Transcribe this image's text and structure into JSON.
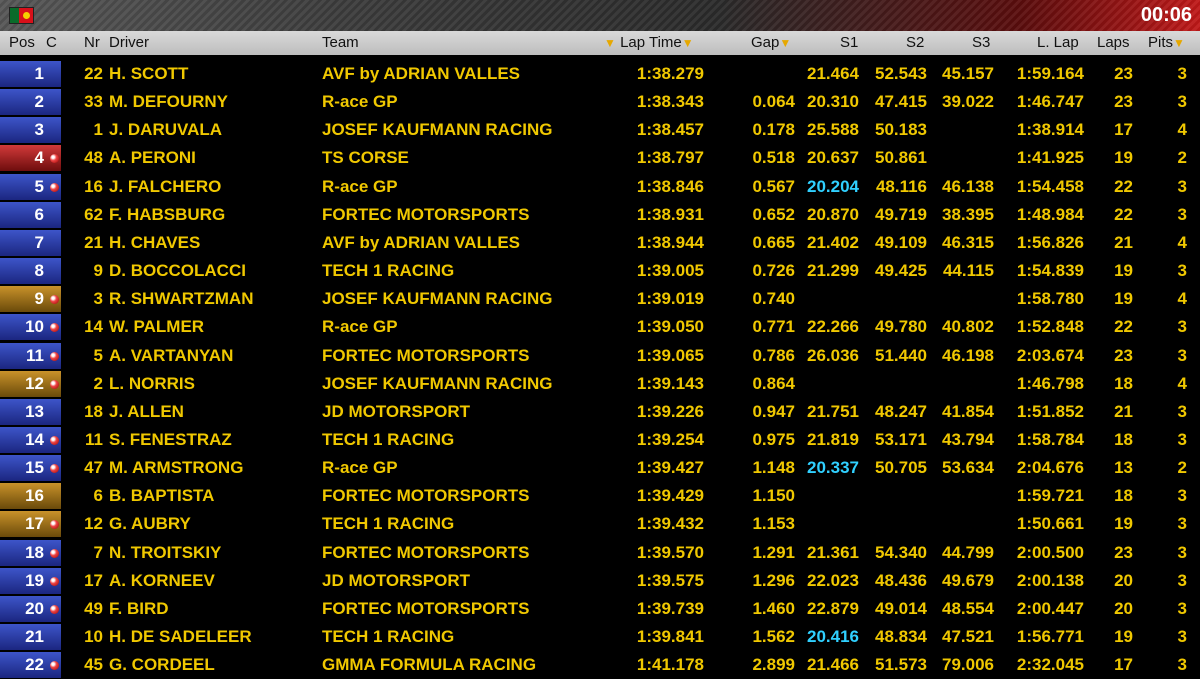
{
  "topbar": {
    "clock": "00:06",
    "flag_icon": "portugal-flag-icon"
  },
  "header": {
    "pos": "Pos",
    "c": "C",
    "nr": "Nr",
    "driver": "Driver",
    "team": "Team",
    "lap_time": "Lap Time",
    "gap": "Gap",
    "s1": "S1",
    "s2": "S2",
    "s3": "S3",
    "last_lap": "L. Lap",
    "laps": "Laps",
    "pits": "Pits"
  },
  "colors": {
    "blue": "#2a3aa8",
    "red": "#b02020",
    "orange": "#a87418",
    "text": "#f0c800",
    "best_sector": "#30d0ff"
  },
  "rows": [
    {
      "pos": "1",
      "status": "blue",
      "dot": false,
      "nr": "22",
      "driver": "H. SCOTT",
      "team": "AVF by ADRIAN VALLES",
      "lap": "1:38.279",
      "gap": "",
      "s1": "21.464",
      "s2": "52.543",
      "s3": "45.157",
      "llap": "1:59.164",
      "laps": "23",
      "pits": "3",
      "s1_best": false
    },
    {
      "pos": "2",
      "status": "blue",
      "dot": false,
      "nr": "33",
      "driver": "M. DEFOURNY",
      "team": "R-ace GP",
      "lap": "1:38.343",
      "gap": "0.064",
      "s1": "20.310",
      "s2": "47.415",
      "s3": "39.022",
      "llap": "1:46.747",
      "laps": "23",
      "pits": "3",
      "s1_best": false
    },
    {
      "pos": "3",
      "status": "blue",
      "dot": false,
      "nr": "1",
      "driver": "J. DARUVALA",
      "team": "JOSEF KAUFMANN RACING",
      "lap": "1:38.457",
      "gap": "0.178",
      "s1": "25.588",
      "s2": "50.183",
      "s3": "",
      "llap": "1:38.914",
      "laps": "17",
      "pits": "4",
      "s1_best": false
    },
    {
      "pos": "4",
      "status": "red",
      "dot": true,
      "nr": "48",
      "driver": "A. PERONI",
      "team": "TS CORSE",
      "lap": "1:38.797",
      "gap": "0.518",
      "s1": "20.637",
      "s2": "50.861",
      "s3": "",
      "llap": "1:41.925",
      "laps": "19",
      "pits": "2",
      "s1_best": false
    },
    {
      "pos": "5",
      "status": "blue",
      "dot": true,
      "nr": "16",
      "driver": "J. FALCHERO",
      "team": "R-ace GP",
      "lap": "1:38.846",
      "gap": "0.567",
      "s1": "20.204",
      "s2": "48.116",
      "s3": "46.138",
      "llap": "1:54.458",
      "laps": "22",
      "pits": "3",
      "s1_best": true
    },
    {
      "pos": "6",
      "status": "blue",
      "dot": false,
      "nr": "62",
      "driver": "F. HABSBURG",
      "team": "FORTEC MOTORSPORTS",
      "lap": "1:38.931",
      "gap": "0.652",
      "s1": "20.870",
      "s2": "49.719",
      "s3": "38.395",
      "llap": "1:48.984",
      "laps": "22",
      "pits": "3",
      "s1_best": false
    },
    {
      "pos": "7",
      "status": "blue",
      "dot": false,
      "nr": "21",
      "driver": "H. CHAVES",
      "team": "AVF by ADRIAN VALLES",
      "lap": "1:38.944",
      "gap": "0.665",
      "s1": "21.402",
      "s2": "49.109",
      "s3": "46.315",
      "llap": "1:56.826",
      "laps": "21",
      "pits": "4",
      "s1_best": false
    },
    {
      "pos": "8",
      "status": "blue",
      "dot": false,
      "nr": "9",
      "driver": "D. BOCCOLACCI",
      "team": "TECH 1 RACING",
      "lap": "1:39.005",
      "gap": "0.726",
      "s1": "21.299",
      "s2": "49.425",
      "s3": "44.115",
      "llap": "1:54.839",
      "laps": "19",
      "pits": "3",
      "s1_best": false
    },
    {
      "pos": "9",
      "status": "orange",
      "dot": true,
      "nr": "3",
      "driver": "R. SHWARTZMAN",
      "team": "JOSEF KAUFMANN RACING",
      "lap": "1:39.019",
      "gap": "0.740",
      "s1": "",
      "s2": "",
      "s3": "",
      "llap": "1:58.780",
      "laps": "19",
      "pits": "4",
      "s1_best": false
    },
    {
      "pos": "10",
      "status": "blue",
      "dot": true,
      "nr": "14",
      "driver": "W. PALMER",
      "team": "R-ace GP",
      "lap": "1:39.050",
      "gap": "0.771",
      "s1": "22.266",
      "s2": "49.780",
      "s3": "40.802",
      "llap": "1:52.848",
      "laps": "22",
      "pits": "3",
      "s1_best": false
    },
    {
      "pos": "11",
      "status": "blue",
      "dot": true,
      "nr": "5",
      "driver": "A. VARTANYAN",
      "team": "FORTEC MOTORSPORTS",
      "lap": "1:39.065",
      "gap": "0.786",
      "s1": "26.036",
      "s2": "51.440",
      "s3": "46.198",
      "llap": "2:03.674",
      "laps": "23",
      "pits": "3",
      "s1_best": false
    },
    {
      "pos": "12",
      "status": "orange",
      "dot": true,
      "nr": "2",
      "driver": "L. NORRIS",
      "team": "JOSEF KAUFMANN RACING",
      "lap": "1:39.143",
      "gap": "0.864",
      "s1": "",
      "s2": "",
      "s3": "",
      "llap": "1:46.798",
      "laps": "18",
      "pits": "4",
      "s1_best": false
    },
    {
      "pos": "13",
      "status": "blue",
      "dot": false,
      "nr": "18",
      "driver": "J. ALLEN",
      "team": "JD MOTORSPORT",
      "lap": "1:39.226",
      "gap": "0.947",
      "s1": "21.751",
      "s2": "48.247",
      "s3": "41.854",
      "llap": "1:51.852",
      "laps": "21",
      "pits": "3",
      "s1_best": false
    },
    {
      "pos": "14",
      "status": "blue",
      "dot": true,
      "nr": "11",
      "driver": "S. FENESTRAZ",
      "team": "TECH 1 RACING",
      "lap": "1:39.254",
      "gap": "0.975",
      "s1": "21.819",
      "s2": "53.171",
      "s3": "43.794",
      "llap": "1:58.784",
      "laps": "18",
      "pits": "3",
      "s1_best": false
    },
    {
      "pos": "15",
      "status": "blue",
      "dot": true,
      "nr": "47",
      "driver": "M. ARMSTRONG",
      "team": "R-ace GP",
      "lap": "1:39.427",
      "gap": "1.148",
      "s1": "20.337",
      "s2": "50.705",
      "s3": "53.634",
      "llap": "2:04.676",
      "laps": "13",
      "pits": "2",
      "s1_best": true
    },
    {
      "pos": "16",
      "status": "orange",
      "dot": false,
      "nr": "6",
      "driver": "B. BAPTISTA",
      "team": "FORTEC MOTORSPORTS",
      "lap": "1:39.429",
      "gap": "1.150",
      "s1": "",
      "s2": "",
      "s3": "",
      "llap": "1:59.721",
      "laps": "18",
      "pits": "3",
      "s1_best": false
    },
    {
      "pos": "17",
      "status": "orange",
      "dot": true,
      "nr": "12",
      "driver": "G. AUBRY",
      "team": "TECH 1 RACING",
      "lap": "1:39.432",
      "gap": "1.153",
      "s1": "",
      "s2": "",
      "s3": "",
      "llap": "1:50.661",
      "laps": "19",
      "pits": "3",
      "s1_best": false
    },
    {
      "pos": "18",
      "status": "blue",
      "dot": true,
      "nr": "7",
      "driver": "N. TROITSKIY",
      "team": "FORTEC MOTORSPORTS",
      "lap": "1:39.570",
      "gap": "1.291",
      "s1": "21.361",
      "s2": "54.340",
      "s3": "44.799",
      "llap": "2:00.500",
      "laps": "23",
      "pits": "3",
      "s1_best": false
    },
    {
      "pos": "19",
      "status": "blue",
      "dot": true,
      "nr": "17",
      "driver": "A. KORNEEV",
      "team": "JD MOTORSPORT",
      "lap": "1:39.575",
      "gap": "1.296",
      "s1": "22.023",
      "s2": "48.436",
      "s3": "49.679",
      "llap": "2:00.138",
      "laps": "20",
      "pits": "3",
      "s1_best": false
    },
    {
      "pos": "20",
      "status": "blue",
      "dot": true,
      "nr": "49",
      "driver": "F. BIRD",
      "team": "FORTEC MOTORSPORTS",
      "lap": "1:39.739",
      "gap": "1.460",
      "s1": "22.879",
      "s2": "49.014",
      "s3": "48.554",
      "llap": "2:00.447",
      "laps": "20",
      "pits": "3",
      "s1_best": false
    },
    {
      "pos": "21",
      "status": "blue",
      "dot": false,
      "nr": "10",
      "driver": "H. DE SADELEER",
      "team": "TECH 1 RACING",
      "lap": "1:39.841",
      "gap": "1.562",
      "s1": "20.416",
      "s2": "48.834",
      "s3": "47.521",
      "llap": "1:56.771",
      "laps": "19",
      "pits": "3",
      "s1_best": true
    },
    {
      "pos": "22",
      "status": "blue",
      "dot": true,
      "nr": "45",
      "driver": "G. CORDEEL",
      "team": "GMMA FORMULA RACING",
      "lap": "1:41.178",
      "gap": "2.899",
      "s1": "21.466",
      "s2": "51.573",
      "s3": "79.006",
      "llap": "2:32.045",
      "laps": "17",
      "pits": "3",
      "s1_best": false
    }
  ]
}
